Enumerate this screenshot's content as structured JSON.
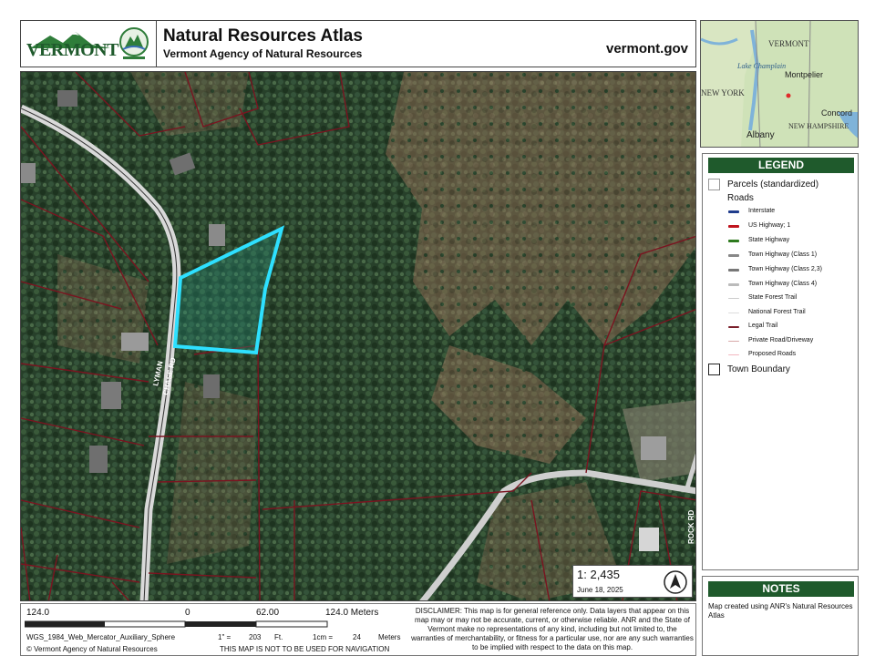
{
  "header": {
    "logo_text": "VERMONT",
    "title": "Natural Resources Atlas",
    "subtitle": "Vermont Agency of Natural Resources",
    "site": "vermont.gov"
  },
  "map": {
    "road_label_left": "LYMAN",
    "road_label_left_2": "CHASE RD",
    "road_label_right": "ROCK RD"
  },
  "inset": {
    "places": [
      "VERMONT",
      "Lake Champlain",
      "Montpelier",
      "NEW YORK",
      "Concord",
      "NEW HAMPSHIRE",
      "Albany"
    ]
  },
  "legend": {
    "title": "LEGEND",
    "parcels": "Parcels (standardized)",
    "roads_heading": "Roads",
    "roads": [
      {
        "label": "Interstate",
        "color": "#1f3c8c"
      },
      {
        "label": "US Highway; 1",
        "color": "#c0141e"
      },
      {
        "label": "State Highway",
        "color": "#2e7a1e"
      },
      {
        "label": "Town Highway (Class 1)",
        "color": "#888888"
      },
      {
        "label": "Town Highway (Class 2,3)",
        "color": "#777777"
      },
      {
        "label": "Town Highway (Class 4)",
        "color": "#bbbbbb"
      },
      {
        "label": "State Forest Trail",
        "color": "#cccccc"
      },
      {
        "label": "National Forest Trail",
        "color": "#dddddd"
      },
      {
        "label": "Legal Trail",
        "color": "#7a1f2b"
      },
      {
        "label": "Private Road/Driveway",
        "color": "#d8a8a8"
      },
      {
        "label": "Proposed Roads",
        "color": "#f3b8c0"
      }
    ],
    "town_boundary": "Town Boundary"
  },
  "notes": {
    "title": "NOTES",
    "text": "Map created using ANR's Natural Resources Atlas"
  },
  "scale": {
    "ratio_prefix": "1:",
    "ratio_value": "2,435",
    "date": "June 18, 2025"
  },
  "footer": {
    "bar_left": "124.0",
    "bar_zero": "0",
    "bar_mid": "62.00",
    "bar_right": "124.0 Meters",
    "projection": "WGS_1984_Web_Mercator_Auxiliary_Sphere",
    "inch_label": "1\" =",
    "inch_value": "203",
    "inch_unit": "Ft.",
    "cm_label": "1cm =",
    "cm_value": "24",
    "cm_unit": "Meters",
    "copyright": "© Vermont Agency of Natural Resources",
    "navigation": "THIS MAP IS NOT TO BE USED FOR NAVIGATION",
    "disclaimer": "DISCLAIMER: This map is for general reference only. Data layers that appear on this map may or may not be accurate, current, or otherwise reliable. ANR and the State of Vermont make no representations of any kind, including but not limited to, the warranties of merchantability, or fitness for a particular use, nor are any such warranties to be implied with respect to the data on this map."
  }
}
